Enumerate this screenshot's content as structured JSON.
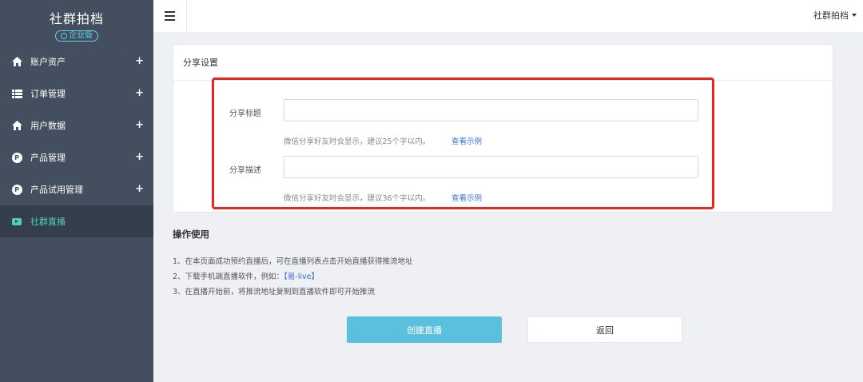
{
  "sidebar": {
    "brand": "社群拍档",
    "badge": "企业版",
    "items": [
      {
        "label": "账户资产",
        "icon": "home-icon"
      },
      {
        "label": "订单管理",
        "icon": "list-icon"
      },
      {
        "label": "用户数据",
        "icon": "home-icon"
      },
      {
        "label": "产品管理",
        "icon": "p-icon"
      },
      {
        "label": "产品试用管理",
        "icon": "p-icon"
      },
      {
        "label": "社群直播",
        "icon": "live-icon",
        "active": true
      }
    ],
    "expand_symbol": "+",
    "p_symbol": "P"
  },
  "topbar": {
    "user": "社群拍档"
  },
  "share_settings": {
    "title": "分享设置",
    "share_title_label": "分享标题",
    "share_title_value": "",
    "share_title_hint": "微信分享好友时会显示，建议25个字以内。",
    "share_desc_label": "分享描述",
    "share_desc_value": "",
    "share_desc_hint": "微信分享好友时会显示，建议36个字以内。",
    "example_link": "查看示例"
  },
  "operations": {
    "title": "操作使用",
    "step1": "1、在本页面成功预约直播后，可在直播列表点击开始直播获得推流地址",
    "step2_prefix": "2、下载手机端直播软件，例如：",
    "step2_link": "【易-live】",
    "step3": "3、在直播开始前，将推流地址复制到直播软件即可开始推流"
  },
  "buttons": {
    "create": "创建直播",
    "back": "返回"
  },
  "colors": {
    "sidebar_bg": "#434e5e",
    "active_item_text": "#4fd1b3",
    "primary_button": "#5bc0de",
    "link": "#3b6fd4",
    "highlight_border": "#e8251f"
  }
}
